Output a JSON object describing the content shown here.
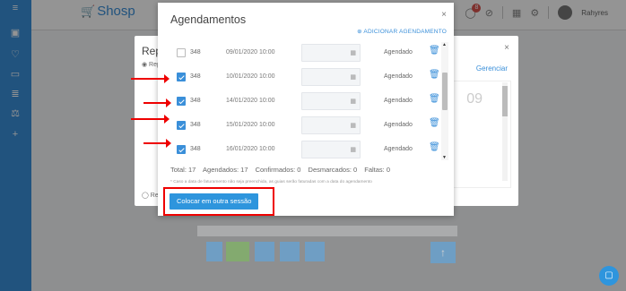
{
  "app": {
    "logo": "Shosp",
    "user": "Rahyres"
  },
  "background": {
    "modal_title": "Repo",
    "gerenciar": "Gerenciar",
    "day": "09"
  },
  "modal": {
    "title": "Agendamentos",
    "close": "×",
    "add_link": "⊕ ADICIONAR AGENDAMENTO",
    "rows": [
      {
        "id": "348",
        "date": "09/01/2020 10:00",
        "status": "Agendado",
        "checked": false
      },
      {
        "id": "348",
        "date": "10/01/2020 10:00",
        "status": "Agendado",
        "checked": true
      },
      {
        "id": "348",
        "date": "14/01/2020 10:00",
        "status": "Agendado",
        "checked": true
      },
      {
        "id": "348",
        "date": "15/01/2020 10:00",
        "status": "Agendado",
        "checked": true
      },
      {
        "id": "348",
        "date": "16/01/2020 10:00",
        "status": "Agendado",
        "checked": true
      }
    ],
    "totals": {
      "total": "Total: 17",
      "agendados": "Agendados: 17",
      "confirmados": "Confirmados: 0",
      "desmarcados": "Desmarcados: 0",
      "faltas": "Faltas: 0"
    },
    "note": "* Caso a data de faturamento não seja preenchida, as guias serão faturadas com a data do agendamento",
    "button": "Colocar em outra sessão"
  },
  "colors": {
    "accent": "#2e95dd",
    "annotation": "#e00000"
  }
}
